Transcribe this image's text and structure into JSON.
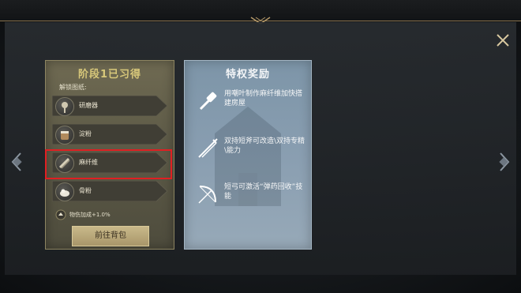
{
  "stage_card": {
    "title": "阶段1已习得",
    "unlock_label": "解锁图纸:",
    "recipes": [
      {
        "label": "研磨器",
        "icon": "grinder-icon"
      },
      {
        "label": "淀粉",
        "icon": "starch-bucket-icon"
      },
      {
        "label": "麻纤维",
        "icon": "hemp-fiber-icon",
        "highlighted": true
      },
      {
        "label": "骨粉",
        "icon": "bone-meal-icon"
      }
    ],
    "bonus": {
      "icon": "buff-icon",
      "text": "物伤加成+1.0%"
    },
    "goto_button": "前往背包"
  },
  "privilege_card": {
    "title": "特权奖励",
    "items": [
      {
        "icon": "mace-hammer-icon",
        "text": "用嘲叶制作麻纤维加快搭建房屋"
      },
      {
        "icon": "dual-spear-icon",
        "text": "双持短斧可改造\\双持专精\\能力"
      },
      {
        "icon": "bow-arrow-icon",
        "text": "短弓可激活“弹药回收”技能"
      }
    ]
  },
  "colors": {
    "highlight": "#e01f22",
    "stage_title": "#d8c87a",
    "button": "#c9b98a"
  }
}
